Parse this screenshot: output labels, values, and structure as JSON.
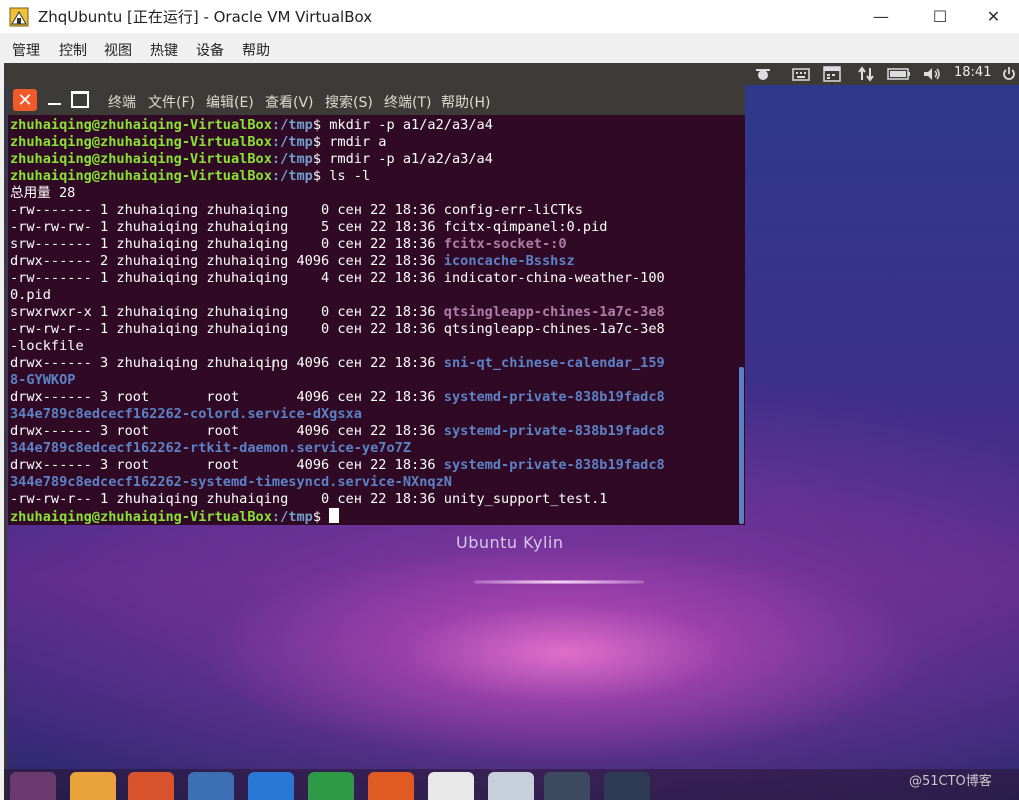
{
  "vbox": {
    "title": "ZhqUbuntu [正在运行] - Oracle VM VirtualBox",
    "controls": {
      "minimize": "—",
      "maximize": "☐",
      "close": "✕"
    },
    "menu": [
      "管理",
      "控制",
      "视图",
      "热键",
      "设备",
      "帮助"
    ]
  },
  "topbar": {
    "clock": "18:41",
    "tray_icons": [
      "indicator-icon",
      "keyboard-icon",
      "calendar-icon",
      "network-arrows-icon",
      "battery-icon",
      "volume-icon",
      "power-icon"
    ]
  },
  "desktop": {
    "brand": "Ubuntu Kylin",
    "watermark": "@51CTO博客"
  },
  "terminal": {
    "controls": {
      "close": "✕"
    },
    "menu": [
      "终端",
      "文件(F)",
      "编辑(E)",
      "查看(V)",
      "搜索(S)",
      "终端(T)",
      "帮助(H)"
    ],
    "prompt_user": "zhuhaiqing@zhuhaiqing-VirtualBox",
    "prompt_path": ":/tmp",
    "prompt_symbol": "$ ",
    "commands": [
      "mkdir -p a1/a2/a3/a4",
      "rmdir a",
      "rmdir -p a1/a2/a3/a4",
      "ls -l"
    ],
    "total": "总用量 28",
    "listing": [
      {
        "meta": "-rw------- 1 zhuhaiqing zhuhaiqing    0 сен 22 18:36 ",
        "name": "config-err-liCTks",
        "kind": "file"
      },
      {
        "meta": "-rw-rw-rw- 1 zhuhaiqing zhuhaiqing    5 сен 22 18:36 ",
        "name": "fcitx-qimpanel:0.pid",
        "kind": "file"
      },
      {
        "meta": "srw------- 1 zhuhaiqing zhuhaiqing    0 сен 22 18:36 ",
        "name": "fcitx-socket-:0",
        "kind": "sock"
      },
      {
        "meta": "drwx------ 2 zhuhaiqing zhuhaiqing 4096 сен 22 18:36 ",
        "name": "iconcache-Bsshsz",
        "kind": "dir"
      },
      {
        "meta": "-rw------- 1 zhuhaiqing zhuhaiqing    4 сен 22 18:36 ",
        "name": "indicator-china-weather-100",
        "cont": "0.pid",
        "kind": "file"
      },
      {
        "meta": "srwxrwxr-x 1 zhuhaiqing zhuhaiqing    0 сен 22 18:36 ",
        "name": "qtsingleapp-chines-1a7c-3e8",
        "kind": "sock"
      },
      {
        "meta": "-rw-rw-r-- 1 zhuhaiqing zhuhaiqing    0 сен 22 18:36 ",
        "name": "qtsingleapp-chines-1a7c-3e8",
        "cont": "-lockfile",
        "kind": "file"
      },
      {
        "meta": "drwx------ 3 zhuhaiqing zhuhaiqing 4096 сен 22 18:36 ",
        "name": "sni-qt_chinese-calendar_159",
        "cont": "8-GYWKOP",
        "kind": "dir"
      },
      {
        "meta": "drwx------ 3 root       root       4096 сен 22 18:36 ",
        "name": "systemd-private-838b19fadc8",
        "cont": "344e789c8edcecf162262-colord.service-dXgsxa",
        "kind": "dir"
      },
      {
        "meta": "drwx------ 3 root       root       4096 сен 22 18:36 ",
        "name": "systemd-private-838b19fadc8",
        "cont": "344e789c8edcecf162262-rtkit-daemon.service-ye7o7Z",
        "kind": "dir"
      },
      {
        "meta": "drwx------ 3 root       root       4096 сен 22 18:36 ",
        "name": "systemd-private-838b19fadc8",
        "cont": "344e789c8edcecf162262-systemd-timesyncd.service-NXnqzN",
        "kind": "dir"
      },
      {
        "meta": "-rw-rw-r-- 1 zhuhaiqing zhuhaiqing    0 сен 22 18:36 ",
        "name": "unity_support_test.1",
        "kind": "file"
      }
    ]
  },
  "dock": {
    "apps": [
      {
        "name": "dash-icon",
        "color": "#6b3a6e"
      },
      {
        "name": "files-icon",
        "color": "#e9a33a"
      },
      {
        "name": "firefox-icon",
        "color": "#d9542c"
      },
      {
        "name": "browser-icon",
        "color": "#3c6fb3"
      },
      {
        "name": "wps-writer-icon",
        "color": "#2a78d6"
      },
      {
        "name": "wps-spreadsheet-icon",
        "color": "#2f9a45"
      },
      {
        "name": "wps-presentation-icon",
        "color": "#e05a24"
      },
      {
        "name": "software-center-icon",
        "color": "#e8e8e8"
      },
      {
        "name": "system-settings-icon",
        "color": "#c7d0da"
      },
      {
        "name": "editor-icon",
        "color": "#3b4a5e"
      },
      {
        "name": "terminal-app-icon",
        "color": "#2d3b55"
      }
    ]
  }
}
